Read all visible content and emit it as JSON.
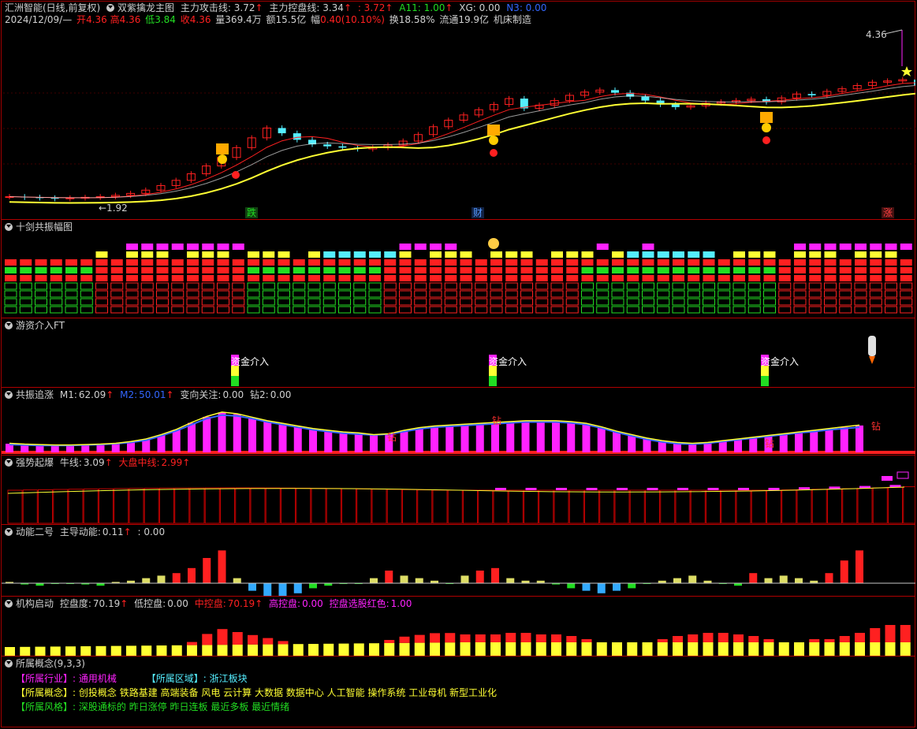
{
  "colors": {
    "red": "#ff2020",
    "cyan": "#55eeff",
    "yellow": "#ffff33",
    "magenta": "#ff22ff",
    "green": "#22dd22",
    "blue": "#3366ff",
    "white": "#ffffff",
    "gray": "#c8c8c8"
  },
  "main": {
    "title": "汇洲智能(日线,前复权)",
    "indicator": "双紫擒龙主图",
    "attack_label": "主力攻击线:",
    "attack_val": "3.72",
    "control_label": "主力控盘线:",
    "control_val": "3.34",
    "extra_val": ": 3.72",
    "a11_label": "A11:",
    "a11_val": "1.00",
    "xg": "XG: 0.00",
    "n3": "N3: 0.00",
    "date": "2024/12/09/—",
    "open_label": "开",
    "open": "4.36",
    "high_label": "高",
    "high": "4.36",
    "low_label": "低",
    "low": "3.84",
    "close_label": "收",
    "close": "4.36",
    "vol": "量369.4万",
    "amount": "额15.5亿",
    "amp_label": "幅",
    "amp": "0.40(10.10%)",
    "turnover": "换18.58%",
    "float": "流通19.9亿",
    "industry": "机床制造",
    "price_high": "4.36",
    "price_low": "←1.92",
    "tags": [
      "跌",
      "财",
      "涨"
    ]
  },
  "panel2": {
    "title": "十剑共振幅图",
    "icon": "money-bag-icon"
  },
  "panel3": {
    "title": "游资介入FT",
    "labels": [
      "资金介入",
      "资金介入",
      "资金介入"
    ],
    "icon": "rocket-icon"
  },
  "panel4": {
    "title": "共振追涨",
    "m1_label": "M1:",
    "m1": "62.09",
    "m2_label": "M2:",
    "m2": "50.01",
    "turn_label": "变向关注:",
    "turn": "0.00",
    "zuan2_label": "钻2:",
    "zuan2": "0.00",
    "marks": [
      "钻",
      "钻",
      "钻",
      "钻"
    ]
  },
  "panel5": {
    "title": "强势起爆",
    "bull_label": "牛线:",
    "bull": "3.09",
    "mid_label": "大盘中线:",
    "mid": "2.99"
  },
  "panel6": {
    "title": "动能二号",
    "lead_label": "主导动能:",
    "lead": "0.11",
    "extra": ": 0.00"
  },
  "panel7": {
    "title": "机构启动",
    "degree_label": "控盘度:",
    "degree": "70.19",
    "low_label": "低控盘:",
    "low": "0.00",
    "mid_label": "中控盘:",
    "mid": "70.19",
    "high_label": "高控盘:",
    "high": "0.00",
    "pick_label": "控盘选股红色:",
    "pick": "1.00"
  },
  "concepts": {
    "title": "所属概念(9,3,3)",
    "industry_key": "【所属行业】:",
    "industry_val": "通用机械",
    "region_key": "【所属区域】:",
    "region_val": "浙江板块",
    "concept_key": "【所属概念】:",
    "concept_val": "创投概念 铁路基建 高端装备 风电 云计算 大数据 数据中心 人工智能 操作系统 工业母机 新型工业化",
    "style_key": "【所属风格】:",
    "style_val": "深股通标的 昨日涨停 昨日连板 最近多板 最近情绪"
  },
  "chart_data": [
    {
      "type": "candlestick",
      "title": "双紫擒龙主图",
      "ylim": [
        1.8,
        4.5
      ],
      "closes": [
        1.95,
        1.94,
        1.93,
        1.92,
        1.93,
        1.94,
        1.95,
        1.97,
        2.0,
        2.05,
        2.12,
        2.2,
        2.3,
        2.42,
        2.55,
        2.7,
        2.85,
        3.0,
        2.92,
        2.82,
        2.75,
        2.72,
        2.7,
        2.68,
        2.7,
        2.74,
        2.8,
        2.9,
        3.02,
        3.12,
        3.2,
        3.28,
        3.36,
        3.45,
        3.3,
        3.35,
        3.42,
        3.5,
        3.55,
        3.58,
        3.54,
        3.48,
        3.42,
        3.36,
        3.32,
        3.34,
        3.38,
        3.4,
        3.42,
        3.44,
        3.4,
        3.46,
        3.52,
        3.5,
        3.56,
        3.6,
        3.65,
        3.7,
        3.72,
        3.74,
        3.66,
        3.76,
        3.82,
        3.9,
        4.36
      ]
    },
    {
      "type": "bar",
      "title": "共振追涨",
      "series": [
        {
          "name": "M1",
          "values": [
            20,
            18,
            17,
            16,
            16,
            17,
            18,
            20,
            24,
            30,
            40,
            52,
            68,
            82,
            92,
            88,
            80,
            72,
            66,
            60,
            54,
            50,
            46,
            44,
            40,
            42,
            50,
            56,
            60,
            62,
            64,
            66,
            68,
            70,
            72,
            72,
            72,
            70,
            66,
            58,
            48,
            40,
            32,
            26,
            22,
            20,
            22,
            26,
            30,
            34,
            38,
            42,
            46,
            50,
            54,
            58,
            62
          ]
        },
        {
          "name": "M2",
          "values": [
            18,
            17,
            16,
            16,
            16,
            17,
            18,
            20,
            23,
            28,
            38,
            50,
            64,
            78,
            86,
            84,
            78,
            70,
            64,
            58,
            52,
            48,
            44,
            42,
            40,
            42,
            48,
            54,
            58,
            60,
            62,
            64,
            66,
            68,
            70,
            70,
            70,
            68,
            64,
            56,
            46,
            38,
            30,
            24,
            20,
            19,
            21,
            25,
            29,
            33,
            37,
            41,
            45,
            48,
            52,
            55,
            58
          ]
        }
      ]
    },
    {
      "type": "bar",
      "title": "动能二号",
      "values": [
        1,
        -1,
        -2,
        0,
        0,
        -1,
        -2,
        1,
        2,
        4,
        6,
        8,
        12,
        20,
        26,
        4,
        -6,
        -12,
        -10,
        -8,
        -4,
        -2,
        0,
        0,
        4,
        10,
        6,
        4,
        2,
        0,
        6,
        10,
        12,
        4,
        2,
        2,
        -1,
        -4,
        -6,
        -8,
        -6,
        -4,
        0,
        2,
        4,
        6,
        2,
        0,
        -2,
        8,
        4,
        6,
        4,
        2,
        8,
        18,
        26
      ]
    }
  ]
}
